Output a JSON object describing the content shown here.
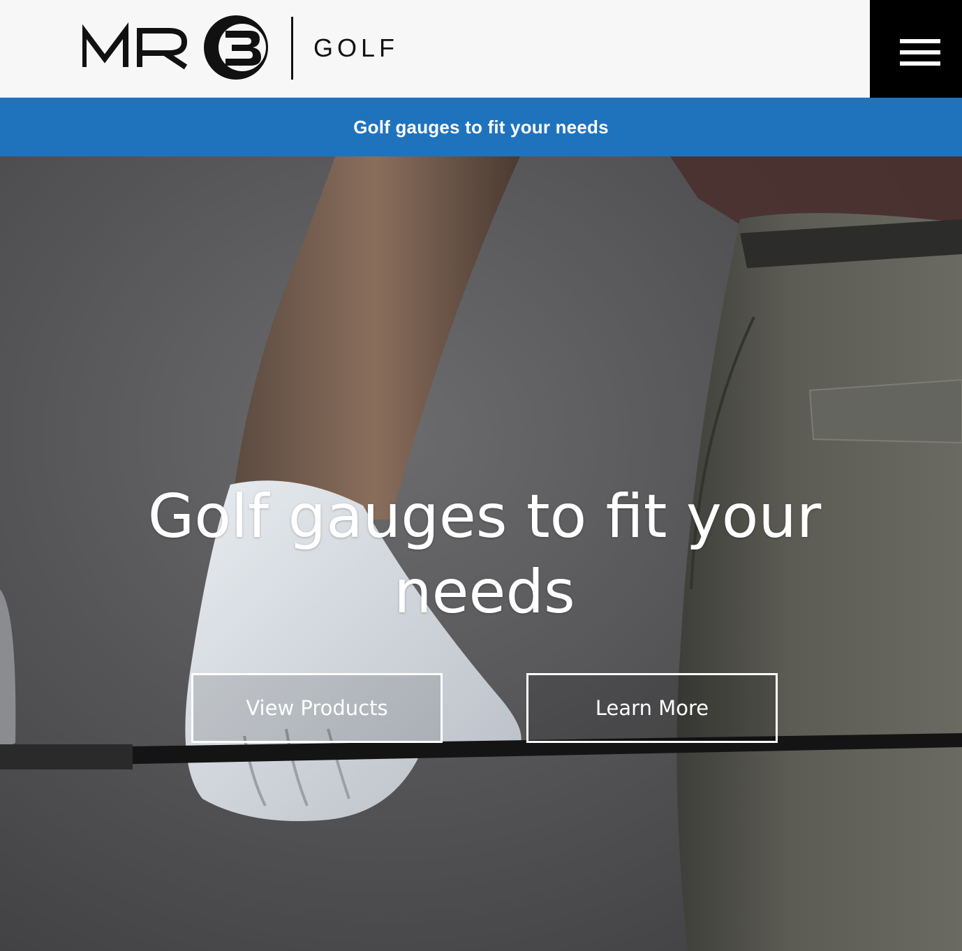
{
  "header": {
    "logo": {
      "mark": "MR3",
      "wordmark": "GOLF"
    },
    "menu_icon": "hamburger-menu-icon"
  },
  "announcement": {
    "text": "Golf gauges to fit your needs"
  },
  "hero": {
    "title": "Golf gauges to fit your needs",
    "image": "golfer-gloved-hand-holding-club-photo",
    "buttons": {
      "view_products": "View Products",
      "learn_more": "Learn More"
    }
  },
  "colors": {
    "header_bg": "#f7f7f7",
    "menu_bg": "#000000",
    "announcement_bg": "#1f73bd",
    "announcement_text": "#ffffff",
    "hero_text": "#ffffff"
  }
}
